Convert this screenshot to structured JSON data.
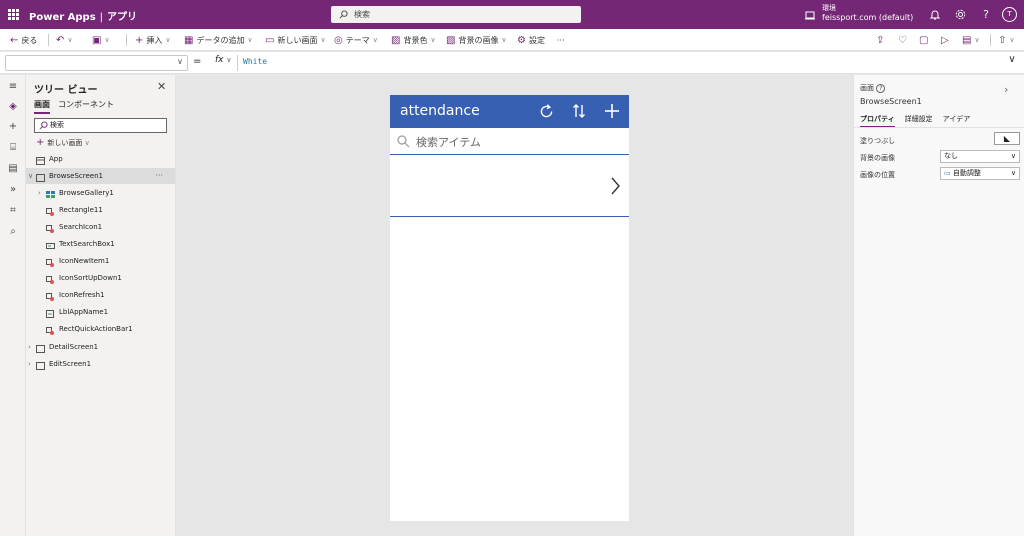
{
  "topbar": {
    "product": "Power Apps",
    "separator": "|",
    "section": "アプリ",
    "search_placeholder": "検索",
    "env_label": "環境",
    "env_name": "feissport.com (default)",
    "avatar_initial": "T",
    "bg_color": "#742774"
  },
  "commands": {
    "back": "戻る",
    "insert": "挿入",
    "add_data": "データの追加",
    "new_screen": "新しい画面",
    "theme": "テーマ",
    "background_color": "背景色",
    "background_image": "背景の画像",
    "settings": "設定",
    "more": "···"
  },
  "formula": {
    "equals": "=",
    "fx": "fx",
    "value": "White"
  },
  "tree": {
    "title": "ツリー ビュー",
    "tab_screens": "画面",
    "tab_components": "コンポーネント",
    "search_placeholder": "検索",
    "new_screen": "新しい画面",
    "more": "···",
    "nodes": [
      {
        "label": "App"
      },
      {
        "label": "BrowseScreen1"
      },
      {
        "label": "BrowseGallery1"
      },
      {
        "label": "Rectangle11"
      },
      {
        "label": "SearchIcon1"
      },
      {
        "label": "TextSearchBox1"
      },
      {
        "label": "IconNewItem1"
      },
      {
        "label": "IconSortUpDown1"
      },
      {
        "label": "IconRefresh1"
      },
      {
        "label": "LblAppName1"
      },
      {
        "label": "RectQuickActionBar1"
      },
      {
        "label": "DetailScreen1"
      },
      {
        "label": "EditScreen1"
      }
    ]
  },
  "app_preview": {
    "title": "attendance",
    "search_placeholder": "検索アイテム",
    "header_color": "#3860b2"
  },
  "properties": {
    "type": "画面",
    "name": "BrowseScreen1",
    "tabs": [
      "プロパティ",
      "詳細設定",
      "アイデア"
    ],
    "fill_label": "塗りつぶし",
    "bg_image_label": "背景の画像",
    "bg_image_value": "なし",
    "image_position_label": "画像の位置",
    "image_position_value": "自動調整"
  }
}
